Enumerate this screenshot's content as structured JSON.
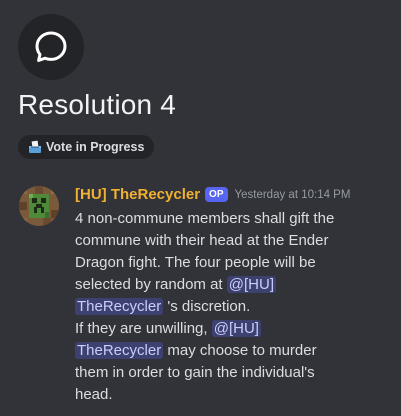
{
  "thread": {
    "icon": "chat-bubble-icon",
    "title": "Resolution 4",
    "tag": {
      "emoji": "ballot-box-icon",
      "label": "Vote in Progress"
    }
  },
  "message": {
    "avatar": "creeper-avatar",
    "username": "[HU] TheRecycler",
    "badge": "OP",
    "timestamp": "Yesterday at 10:14 PM",
    "lines": {
      "l1": "4 non-commune members shall gift the",
      "l2": "commune with their head at the Ender",
      "l3": "Dragon fight. The four people will be",
      "l4": "selected by random at ",
      "m1a": "@[HU]",
      "m1b": "TheRecycler",
      "l5": " 's discretion.",
      "l6": "If they are unwilling, ",
      "m2a": "@[HU]",
      "m2b": "TheRecycler",
      "l7": " may choose to murder",
      "l8": "them in order to gain the individual's",
      "l9": "head."
    }
  },
  "colors": {
    "background": "#323338",
    "username": "#f0b132",
    "op_badge": "#5865f2",
    "mention_bg": "rgba(88,101,242,0.3)"
  }
}
